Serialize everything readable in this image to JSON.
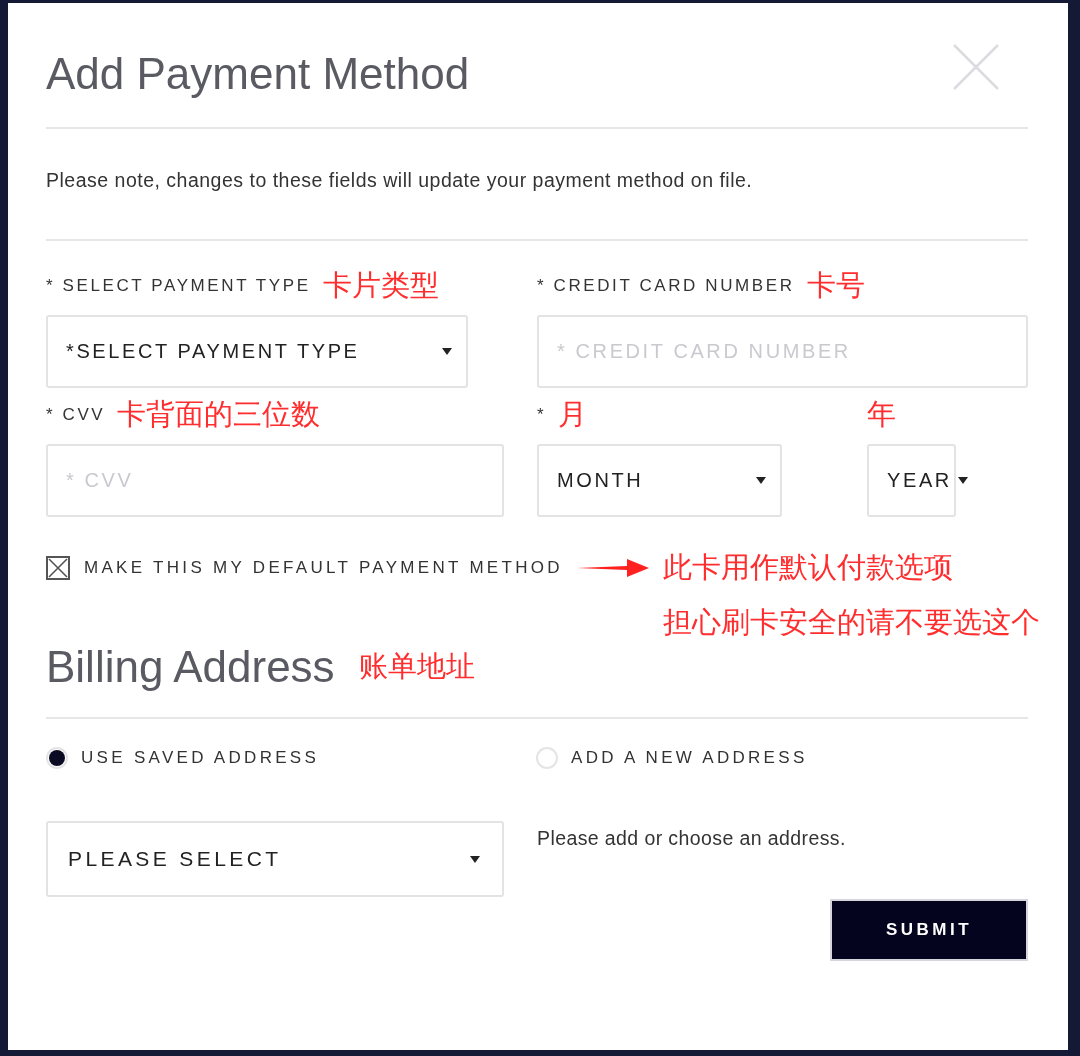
{
  "dialog": {
    "title": "Add Payment Method",
    "notice": "Please note, changes to these fields will update your payment method on file.",
    "fields": [
      {
        "kind": "select",
        "label": "* SELECT PAYMENT TYPE",
        "note": "卡片类型",
        "value": "*SELECT PAYMENT TYPE"
      },
      {
        "kind": "input",
        "label": "* CREDIT CARD NUMBER",
        "note": "卡号",
        "placeholder": "* CREDIT CARD NUMBER"
      },
      {
        "kind": "input",
        "label": "* CVV",
        "note": "卡背面的三位数",
        "placeholder": "* CVV"
      },
      {
        "kind": "select",
        "label": "*",
        "note": "月",
        "value": "MONTH"
      },
      {
        "kind": "select",
        "note": "年",
        "value": "YEAR"
      }
    ],
    "default_checkbox": {
      "label": "MAKE THIS MY DEFAULT PAYMENT METHOD",
      "checked": true,
      "notes": [
        "此卡用作默认付款选项",
        "担心刷卡安全的请不要选这个"
      ]
    },
    "billing": {
      "heading": "Billing Address",
      "note": "账单地址",
      "options": [
        {
          "label": "USE SAVED ADDRESS",
          "selected": true
        },
        {
          "label": "ADD A NEW ADDRESS",
          "selected": false
        }
      ],
      "address_select": {
        "value": "PLEASE SELECT"
      },
      "hint": "Please add or choose an address."
    },
    "submit": "SUBMIT"
  }
}
